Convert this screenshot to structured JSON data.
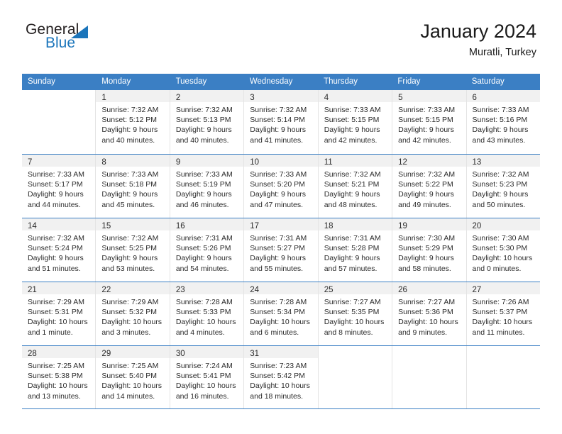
{
  "brand": {
    "name_part1": "General",
    "name_part2": "Blue",
    "logo_icon": "triangle-icon"
  },
  "header": {
    "title": "January 2024",
    "subtitle": "Muratli, Turkey"
  },
  "theme": {
    "header_blue": "#3b7fc4",
    "brand_blue": "#1b75bb",
    "daynum_bg": "#f1f1f1",
    "cell_border": "#e4e4e4"
  },
  "weekdays": [
    "Sunday",
    "Monday",
    "Tuesday",
    "Wednesday",
    "Thursday",
    "Friday",
    "Saturday"
  ],
  "weeks": [
    [
      {
        "day": "",
        "sunrise": "",
        "sunset": "",
        "daylight_1": "",
        "daylight_2": ""
      },
      {
        "day": "1",
        "sunrise": "Sunrise: 7:32 AM",
        "sunset": "Sunset: 5:12 PM",
        "daylight_1": "Daylight: 9 hours",
        "daylight_2": "and 40 minutes."
      },
      {
        "day": "2",
        "sunrise": "Sunrise: 7:32 AM",
        "sunset": "Sunset: 5:13 PM",
        "daylight_1": "Daylight: 9 hours",
        "daylight_2": "and 40 minutes."
      },
      {
        "day": "3",
        "sunrise": "Sunrise: 7:32 AM",
        "sunset": "Sunset: 5:14 PM",
        "daylight_1": "Daylight: 9 hours",
        "daylight_2": "and 41 minutes."
      },
      {
        "day": "4",
        "sunrise": "Sunrise: 7:33 AM",
        "sunset": "Sunset: 5:15 PM",
        "daylight_1": "Daylight: 9 hours",
        "daylight_2": "and 42 minutes."
      },
      {
        "day": "5",
        "sunrise": "Sunrise: 7:33 AM",
        "sunset": "Sunset: 5:15 PM",
        "daylight_1": "Daylight: 9 hours",
        "daylight_2": "and 42 minutes."
      },
      {
        "day": "6",
        "sunrise": "Sunrise: 7:33 AM",
        "sunset": "Sunset: 5:16 PM",
        "daylight_1": "Daylight: 9 hours",
        "daylight_2": "and 43 minutes."
      }
    ],
    [
      {
        "day": "7",
        "sunrise": "Sunrise: 7:33 AM",
        "sunset": "Sunset: 5:17 PM",
        "daylight_1": "Daylight: 9 hours",
        "daylight_2": "and 44 minutes."
      },
      {
        "day": "8",
        "sunrise": "Sunrise: 7:33 AM",
        "sunset": "Sunset: 5:18 PM",
        "daylight_1": "Daylight: 9 hours",
        "daylight_2": "and 45 minutes."
      },
      {
        "day": "9",
        "sunrise": "Sunrise: 7:33 AM",
        "sunset": "Sunset: 5:19 PM",
        "daylight_1": "Daylight: 9 hours",
        "daylight_2": "and 46 minutes."
      },
      {
        "day": "10",
        "sunrise": "Sunrise: 7:33 AM",
        "sunset": "Sunset: 5:20 PM",
        "daylight_1": "Daylight: 9 hours",
        "daylight_2": "and 47 minutes."
      },
      {
        "day": "11",
        "sunrise": "Sunrise: 7:32 AM",
        "sunset": "Sunset: 5:21 PM",
        "daylight_1": "Daylight: 9 hours",
        "daylight_2": "and 48 minutes."
      },
      {
        "day": "12",
        "sunrise": "Sunrise: 7:32 AM",
        "sunset": "Sunset: 5:22 PM",
        "daylight_1": "Daylight: 9 hours",
        "daylight_2": "and 49 minutes."
      },
      {
        "day": "13",
        "sunrise": "Sunrise: 7:32 AM",
        "sunset": "Sunset: 5:23 PM",
        "daylight_1": "Daylight: 9 hours",
        "daylight_2": "and 50 minutes."
      }
    ],
    [
      {
        "day": "14",
        "sunrise": "Sunrise: 7:32 AM",
        "sunset": "Sunset: 5:24 PM",
        "daylight_1": "Daylight: 9 hours",
        "daylight_2": "and 51 minutes."
      },
      {
        "day": "15",
        "sunrise": "Sunrise: 7:32 AM",
        "sunset": "Sunset: 5:25 PM",
        "daylight_1": "Daylight: 9 hours",
        "daylight_2": "and 53 minutes."
      },
      {
        "day": "16",
        "sunrise": "Sunrise: 7:31 AM",
        "sunset": "Sunset: 5:26 PM",
        "daylight_1": "Daylight: 9 hours",
        "daylight_2": "and 54 minutes."
      },
      {
        "day": "17",
        "sunrise": "Sunrise: 7:31 AM",
        "sunset": "Sunset: 5:27 PM",
        "daylight_1": "Daylight: 9 hours",
        "daylight_2": "and 55 minutes."
      },
      {
        "day": "18",
        "sunrise": "Sunrise: 7:31 AM",
        "sunset": "Sunset: 5:28 PM",
        "daylight_1": "Daylight: 9 hours",
        "daylight_2": "and 57 minutes."
      },
      {
        "day": "19",
        "sunrise": "Sunrise: 7:30 AM",
        "sunset": "Sunset: 5:29 PM",
        "daylight_1": "Daylight: 9 hours",
        "daylight_2": "and 58 minutes."
      },
      {
        "day": "20",
        "sunrise": "Sunrise: 7:30 AM",
        "sunset": "Sunset: 5:30 PM",
        "daylight_1": "Daylight: 10 hours",
        "daylight_2": "and 0 minutes."
      }
    ],
    [
      {
        "day": "21",
        "sunrise": "Sunrise: 7:29 AM",
        "sunset": "Sunset: 5:31 PM",
        "daylight_1": "Daylight: 10 hours",
        "daylight_2": "and 1 minute."
      },
      {
        "day": "22",
        "sunrise": "Sunrise: 7:29 AM",
        "sunset": "Sunset: 5:32 PM",
        "daylight_1": "Daylight: 10 hours",
        "daylight_2": "and 3 minutes."
      },
      {
        "day": "23",
        "sunrise": "Sunrise: 7:28 AM",
        "sunset": "Sunset: 5:33 PM",
        "daylight_1": "Daylight: 10 hours",
        "daylight_2": "and 4 minutes."
      },
      {
        "day": "24",
        "sunrise": "Sunrise: 7:28 AM",
        "sunset": "Sunset: 5:34 PM",
        "daylight_1": "Daylight: 10 hours",
        "daylight_2": "and 6 minutes."
      },
      {
        "day": "25",
        "sunrise": "Sunrise: 7:27 AM",
        "sunset": "Sunset: 5:35 PM",
        "daylight_1": "Daylight: 10 hours",
        "daylight_2": "and 8 minutes."
      },
      {
        "day": "26",
        "sunrise": "Sunrise: 7:27 AM",
        "sunset": "Sunset: 5:36 PM",
        "daylight_1": "Daylight: 10 hours",
        "daylight_2": "and 9 minutes."
      },
      {
        "day": "27",
        "sunrise": "Sunrise: 7:26 AM",
        "sunset": "Sunset: 5:37 PM",
        "daylight_1": "Daylight: 10 hours",
        "daylight_2": "and 11 minutes."
      }
    ],
    [
      {
        "day": "28",
        "sunrise": "Sunrise: 7:25 AM",
        "sunset": "Sunset: 5:38 PM",
        "daylight_1": "Daylight: 10 hours",
        "daylight_2": "and 13 minutes."
      },
      {
        "day": "29",
        "sunrise": "Sunrise: 7:25 AM",
        "sunset": "Sunset: 5:40 PM",
        "daylight_1": "Daylight: 10 hours",
        "daylight_2": "and 14 minutes."
      },
      {
        "day": "30",
        "sunrise": "Sunrise: 7:24 AM",
        "sunset": "Sunset: 5:41 PM",
        "daylight_1": "Daylight: 10 hours",
        "daylight_2": "and 16 minutes."
      },
      {
        "day": "31",
        "sunrise": "Sunrise: 7:23 AM",
        "sunset": "Sunset: 5:42 PM",
        "daylight_1": "Daylight: 10 hours",
        "daylight_2": "and 18 minutes."
      },
      {
        "day": "",
        "sunrise": "",
        "sunset": "",
        "daylight_1": "",
        "daylight_2": ""
      },
      {
        "day": "",
        "sunrise": "",
        "sunset": "",
        "daylight_1": "",
        "daylight_2": ""
      },
      {
        "day": "",
        "sunrise": "",
        "sunset": "",
        "daylight_1": "",
        "daylight_2": ""
      }
    ]
  ]
}
